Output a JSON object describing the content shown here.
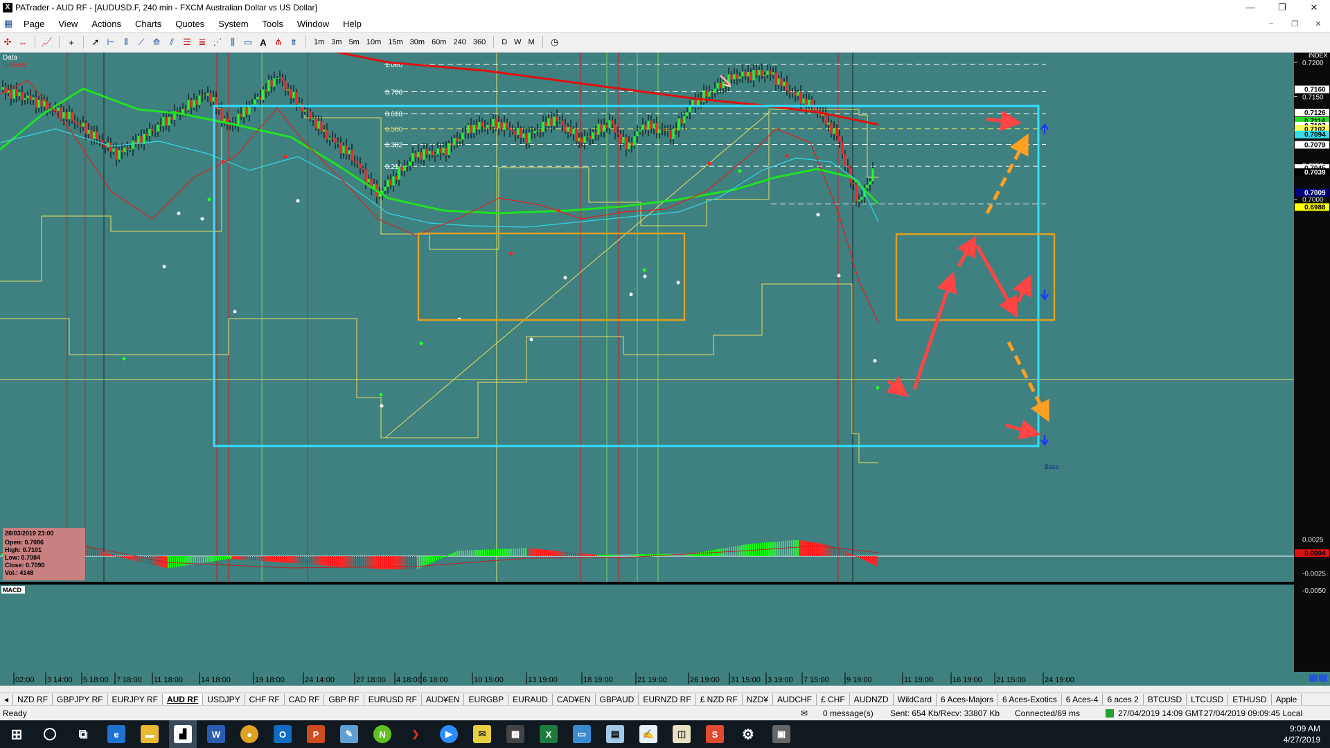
{
  "window": {
    "title": "PATrader - AUD RF - [AUDUSD.F, 240 min - FXCM Australian Dollar vs US Dollar]",
    "app_icon": "X",
    "controls": [
      "—",
      "❐",
      "✕"
    ]
  },
  "menu": {
    "items": [
      "Page",
      "View",
      "Actions",
      "Charts",
      "Quotes",
      "System",
      "Tools",
      "Window",
      "Help"
    ],
    "mdi_controls": [
      "–",
      "❐",
      "✕"
    ]
  },
  "toolbar": {
    "timeframes": [
      "1m",
      "3m",
      "5m",
      "10m",
      "15m",
      "30m",
      "60m",
      "240",
      "360"
    ],
    "periods": [
      "D",
      "W",
      "M"
    ]
  },
  "chart": {
    "data_label": "Data",
    "locked_label": "Locked",
    "index_label": "INDEX",
    "macd_label": "MACD",
    "fib_levels": [
      {
        "label": "1.000",
        "price": 0.7197
      },
      {
        "label": "0.786",
        "price": 0.7157
      },
      {
        "label": "0.618",
        "price": 0.7125
      },
      {
        "label": "0.500",
        "price": 0.7103
      },
      {
        "label": "0.382",
        "price": 0.708
      },
      {
        "label": "0.214",
        "price": 0.7048
      }
    ],
    "y_axis_ticks": [
      0.72,
      0.715,
      0.71,
      0.705,
      0.7
    ],
    "y_axis_tick_labels": [
      "0.7200",
      "0.7150",
      "0.7100",
      "0.7050",
      "0.7000"
    ],
    "price_tags": [
      {
        "label": "0.7160",
        "price": 0.716,
        "bg": "#ffffff",
        "fg": "#000000"
      },
      {
        "label": "0.7126",
        "price": 0.7126,
        "bg": "#ffffff",
        "fg": "#000000"
      },
      {
        "label": "0.7114",
        "price": 0.7114,
        "bg": "#22dd22",
        "fg": "#000000"
      },
      {
        "label": "0.7107",
        "price": 0.7107,
        "bg": "#ffffff",
        "fg": "#000000"
      },
      {
        "label": "0.7102",
        "price": 0.7102,
        "bg": "#ffff55",
        "fg": "#000000"
      },
      {
        "label": "0.7094",
        "price": 0.7094,
        "bg": "#33ddee",
        "fg": "#000000"
      },
      {
        "label": "0.7079",
        "price": 0.7079,
        "bg": "#ffffff",
        "fg": "#000000"
      },
      {
        "label": "0.7045",
        "price": 0.7045,
        "bg": "#ffffff",
        "fg": "#000000"
      },
      {
        "label": "0.7039",
        "price": 0.7039,
        "bg": "#000000",
        "fg": "#ffffff"
      },
      {
        "label": "0.7009",
        "price": 0.7009,
        "bg": "#000080",
        "fg": "#ffffff"
      },
      {
        "label": "0.6988",
        "price": 0.6988,
        "bg": "#ffff00",
        "fg": "#000000"
      }
    ],
    "macd_ticks": [
      {
        "label": "0.0025",
        "value": 0.0025
      },
      {
        "label": "0.0004",
        "value": 0.0004
      },
      {
        "label": "-0.0025",
        "value": -0.0025
      },
      {
        "label": "-0.0050",
        "value": -0.005
      }
    ],
    "x_axis_labels": [
      "02:00",
      "3 14:00",
      "5 18:00",
      "7 18:00",
      "11 18:00",
      "14 18:00",
      "19 18:00",
      "24 14:00",
      "27 18:00",
      "4 18:00",
      "6 18:00",
      "10 15:00",
      "13 19:00",
      "18 19:00",
      "21 19:00",
      "26 19:00",
      "31 15:00",
      "3 19:00",
      "7 15:00",
      "9 19:00",
      "11 19:00",
      "16 19:00",
      "21 15:00",
      "24 19:00"
    ],
    "data_box": {
      "date": "28/03/2019 23:00",
      "open": "Open: 0.7086",
      "high": "High: 0.7101",
      "low": "Low: 0.7084",
      "close": "Close: 0.7090",
      "vol": "Vol.: 4148"
    },
    "base_label": "Base",
    "colors": {
      "background": "#3f8080",
      "up_candle": "#22ff22",
      "down_candle": "#ff2222",
      "cyan_box": "#33e0ff",
      "orange_box": "#e0a020",
      "arrow_red": "#ff4444",
      "arrow_orange": "#ffa020"
    }
  },
  "symbol_tabs": [
    "NZD RF",
    "GBPJPY RF",
    "EURJPY RF",
    "AUD RF",
    "USDJPY",
    "CHF RF",
    "CAD RF",
    "GBP RF",
    "EURUSD RF",
    "AUD¥EN",
    "EURGBP",
    "EURAUD",
    "CAD¥EN",
    "GBPAUD",
    "EURNZD RF",
    "£ NZD RF",
    "NZD¥",
    "AUDCHF",
    "£ CHF",
    "AUDNZD",
    "WildCard",
    "6 Aces-Majors",
    "6 Aces-Exotics",
    "6 Aces-4",
    "6 aces 2",
    "BTCUSD",
    "LTCUSD",
    "ETHUSD",
    "Apple"
  ],
  "active_tab": "AUD RF",
  "status": {
    "ready": "Ready",
    "messages": "0 message(s)",
    "traffic": "Sent: 654 Kb/Recv: 33807 Kb",
    "connection": "Connected/69 ms",
    "server_time": "27/04/2019 14:09 GMT",
    "local_time": "27/04/2019 09:09:45 Local"
  },
  "taskbar": {
    "time": "9:09 AM",
    "date": "4/27/2019"
  }
}
